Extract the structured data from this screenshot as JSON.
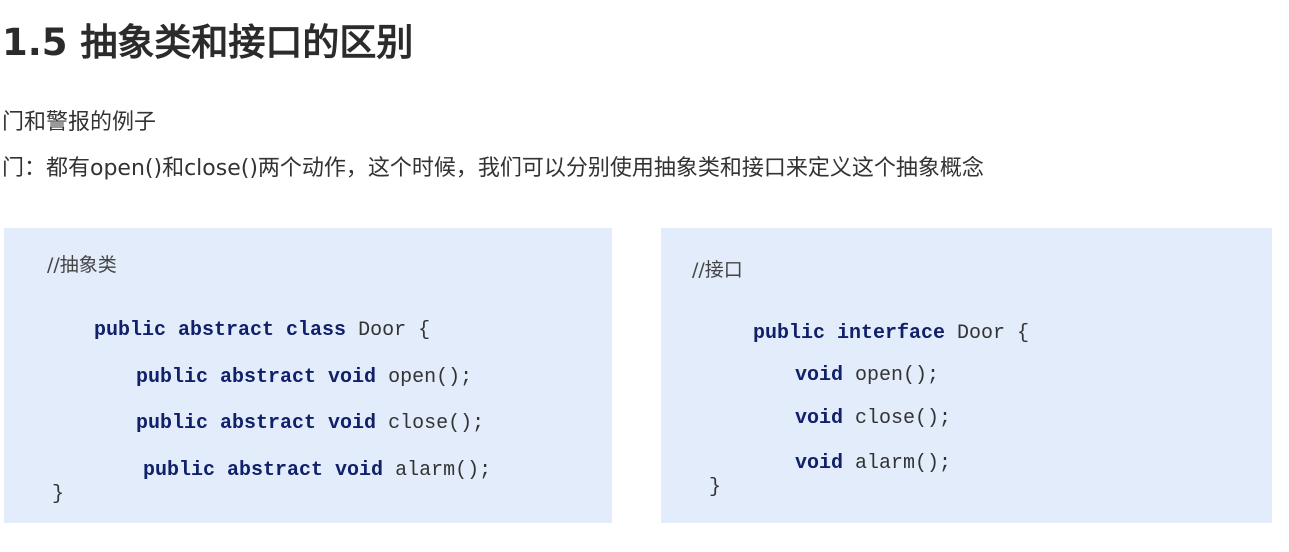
{
  "title": "1.5 抽象类和接口的区别",
  "intro": {
    "line1": "门和警报的例子",
    "line2": "门：都有open()和close()两个动作，这个时候，我们可以分别使用抽象类和接口来定义这个抽象概念"
  },
  "abstract_code": {
    "comment": "//抽象类",
    "decl": {
      "kw": "public abstract class",
      "rest": " Door {"
    },
    "methods": [
      {
        "kw": "public abstract void",
        "rest": " open();"
      },
      {
        "kw": "public abstract void",
        "rest": " close();"
      },
      {
        "kw": "public abstract void",
        "rest": " alarm();"
      }
    ],
    "close": "}"
  },
  "interface_code": {
    "comment": "//接口",
    "decl": {
      "kw": "public interface",
      "rest": " Door {"
    },
    "methods": [
      {
        "kw": "void",
        "rest": " open();"
      },
      {
        "kw": "void",
        "rest": " close();"
      },
      {
        "kw": "void",
        "rest": " alarm();"
      }
    ],
    "close": "}"
  }
}
